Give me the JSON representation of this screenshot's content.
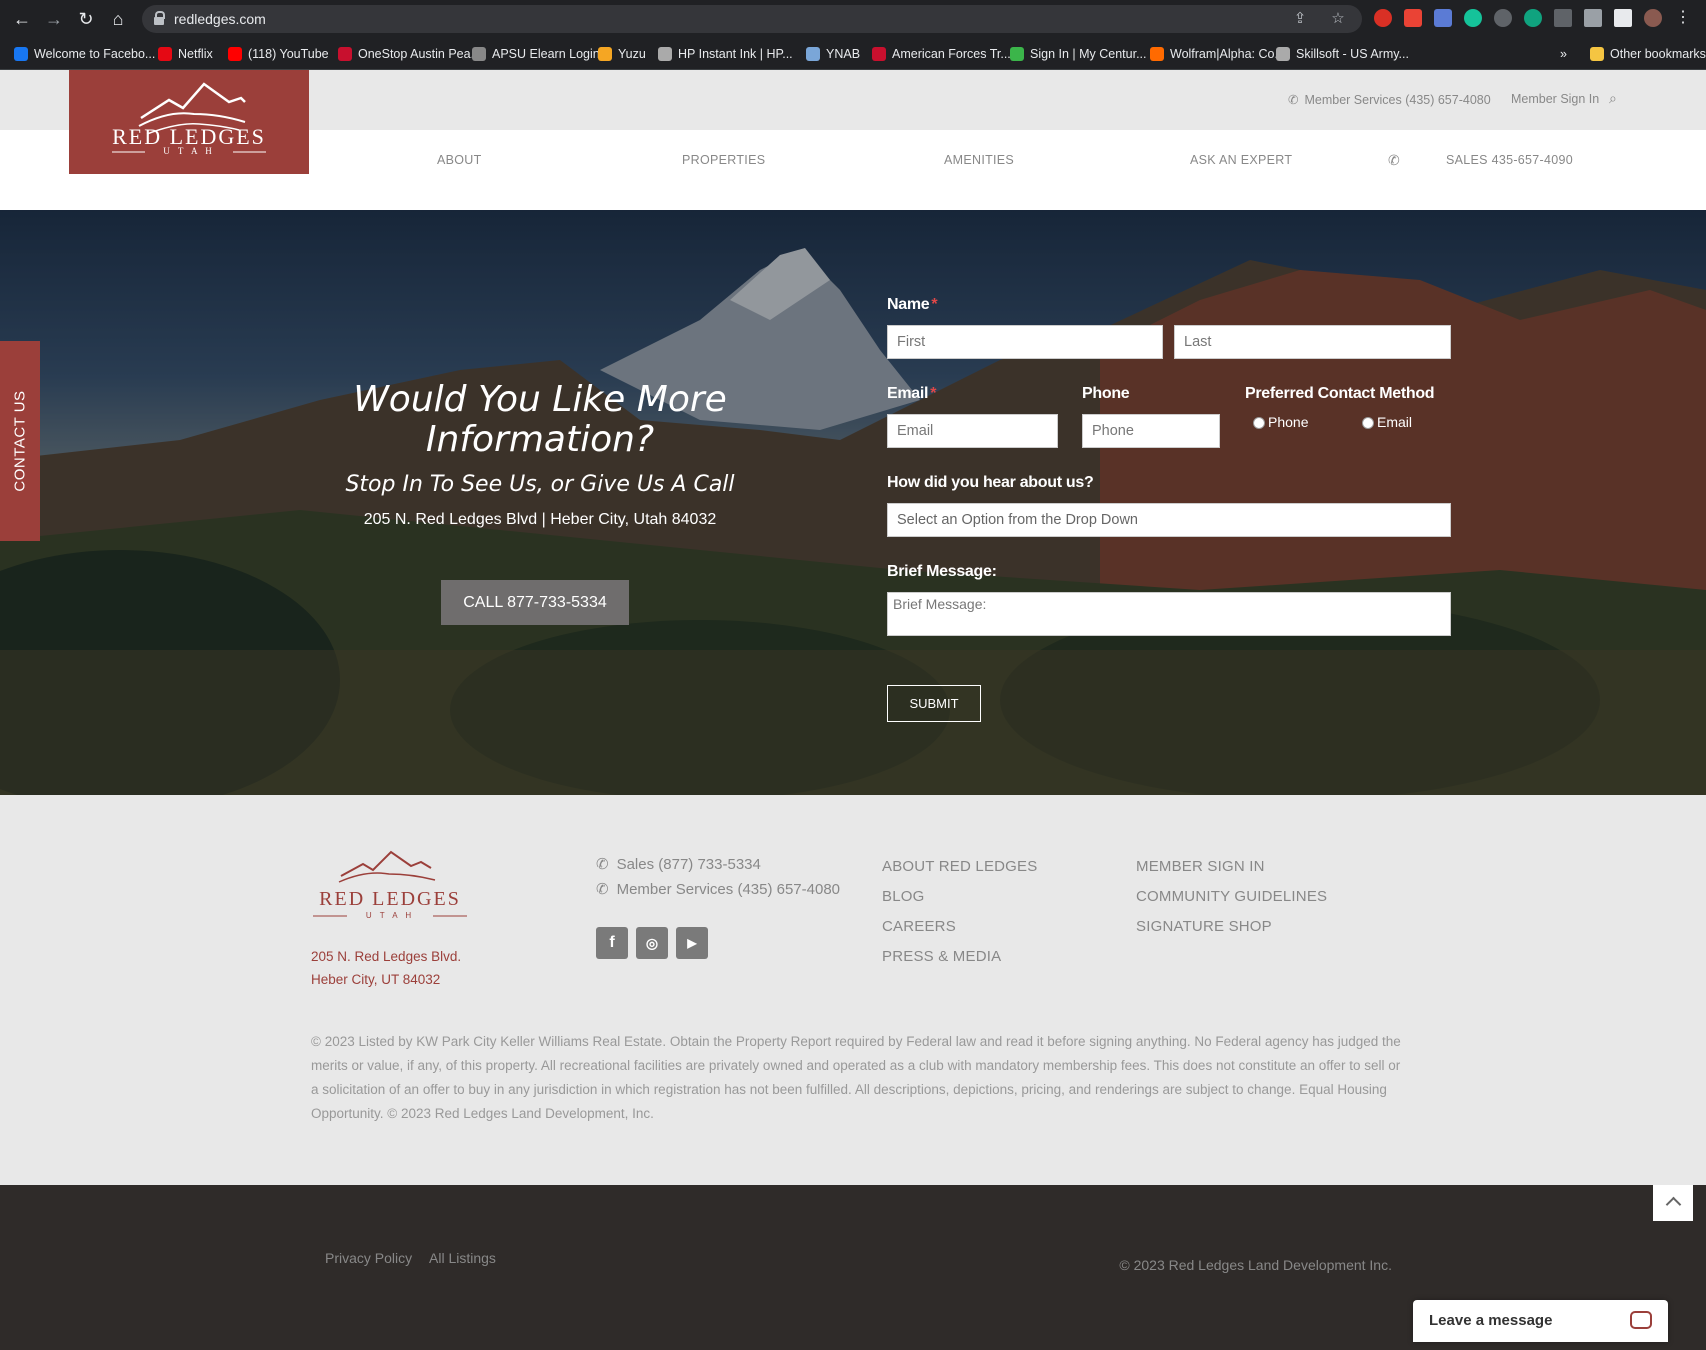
{
  "browser": {
    "url": "redledges.com",
    "bookmarks": [
      {
        "label": "Welcome to Facebo...",
        "color": "#1877f2"
      },
      {
        "label": "Netflix",
        "color": "#e50914"
      },
      {
        "label": "(118) YouTube",
        "color": "#ff0000"
      },
      {
        "label": "OneStop Austin Pea...",
        "color": "#c8102e"
      },
      {
        "label": "APSU Elearn Login",
        "color": "#888888"
      },
      {
        "label": "Yuzu",
        "color": "#f5a623"
      },
      {
        "label": "HP Instant Ink | HP...",
        "color": "#aaaaaa"
      },
      {
        "label": "YNAB",
        "color": "#7aa6d8"
      },
      {
        "label": "American Forces Tr...",
        "color": "#c8102e"
      },
      {
        "label": "Sign In | My Centur...",
        "color": "#3bb54a"
      },
      {
        "label": "Wolfram|Alpha: Co...",
        "color": "#ff6a00"
      },
      {
        "label": "Skillsoft - US Army...",
        "color": "#aaaaaa"
      }
    ],
    "more": "»",
    "other_bookmarks": "Other bookmarks"
  },
  "header": {
    "logo_main": "RED LEDGES",
    "logo_sub": "U T A H",
    "member_services": "Member Services (435) 657-4080",
    "member_sign_in": "Member Sign In",
    "nav": [
      "ABOUT",
      "PROPERTIES",
      "AMENITIES",
      "ASK AN EXPERT"
    ],
    "sales": "SALES 435-657-4090"
  },
  "hero": {
    "contact_tab": "CONTACT US",
    "title": "Would You Like More Information?",
    "subtitle": "Stop In To See Us, or Give Us A Call",
    "address": "205 N. Red Ledges Blvd | Heber City, Utah 84032",
    "call_button": "CALL 877-733-5334"
  },
  "form": {
    "name_label": "Name",
    "first_placeholder": "First",
    "last_placeholder": "Last",
    "email_label": "Email",
    "email_placeholder": "Email",
    "phone_label": "Phone",
    "phone_placeholder": "Phone",
    "pref_label": "Preferred Contact Method",
    "pref_options": [
      "Phone",
      "Email"
    ],
    "hear_label": "How did you hear about us?",
    "hear_value": "Select an Option from the Drop Down",
    "message_label": "Brief Message:",
    "message_placeholder": "Brief Message:",
    "submit": "SUBMIT",
    "required_mark": "*"
  },
  "footer": {
    "logo_main": "RED LEDGES",
    "logo_sub": "U T A H",
    "address_line1": "205 N. Red Ledges Blvd.",
    "address_line2": "Heber City, UT 84032",
    "sales_phone": "Sales (877) 733-5334",
    "member_phone": "Member Services (435) 657-4080",
    "links_col1": [
      "ABOUT RED LEDGES",
      "BLOG",
      "CAREERS",
      "PRESS & MEDIA"
    ],
    "links_col2": [
      "MEMBER SIGN IN",
      "COMMUNITY GUIDELINES",
      "SIGNATURE SHOP"
    ],
    "disclaimer": "© 2023 Listed by KW Park City Keller Williams Real Estate. Obtain the Property Report required by Federal law and read it before signing anything. No Federal agency has judged the merits or value, if any, of this property. All recreational facilities are privately owned and operated as a club with mandatory membership fees. This does not constitute an offer to sell or a solicitation of an offer to buy in any jurisdiction in which registration has not been fulfilled. All descriptions, depictions, pricing, and renderings are subject to change. Equal Housing Opportunity. © 2023 Red Ledges Land Development, Inc."
  },
  "bottom": {
    "privacy": "Privacy Policy",
    "listings": "All Listings",
    "copyright": "© 2023 Red Ledges Land Development Inc.",
    "chat_label": "Leave a message"
  },
  "colors": {
    "brand_red": "#9b3f3a",
    "footer_dark": "#2f2b29"
  }
}
